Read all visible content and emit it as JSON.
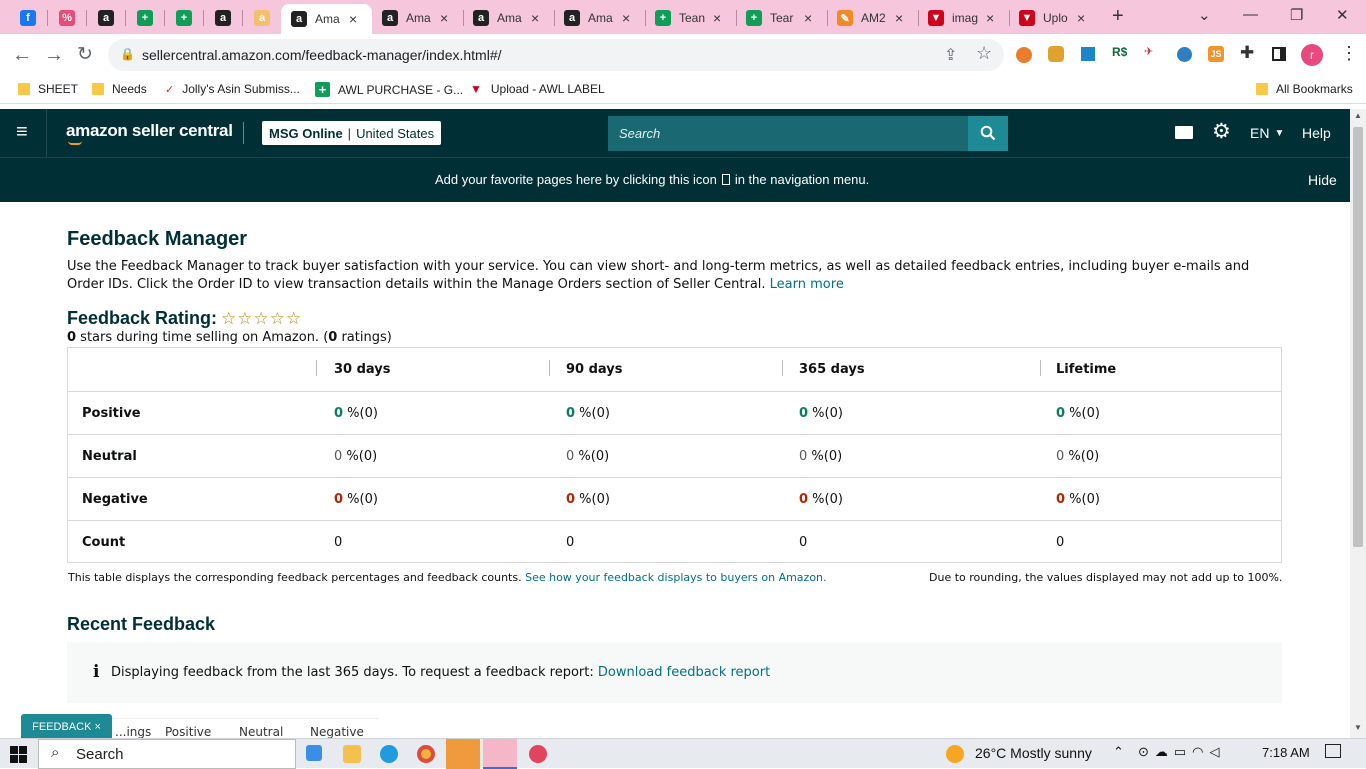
{
  "browser": {
    "tabs": [
      {
        "label": "",
        "icon": "facebook-icon",
        "color": "#1877f2",
        "glyph": "f"
      },
      {
        "label": "",
        "icon": "percent-icon",
        "color": "#e84c7d",
        "glyph": "%"
      },
      {
        "label": "",
        "icon": "amazon-icon",
        "color": "#222",
        "glyph": "a"
      },
      {
        "label": "",
        "icon": "sheets-icon",
        "color": "#0f9d58",
        "glyph": "+"
      },
      {
        "label": "",
        "icon": "sheets-icon",
        "color": "#0f9d58",
        "glyph": "+"
      },
      {
        "label": "",
        "icon": "amazon-icon",
        "color": "#222",
        "glyph": "a"
      },
      {
        "label": "",
        "icon": "amazon-smile-icon",
        "color": "#f3c16b",
        "glyph": "a"
      },
      {
        "label": "Ama",
        "icon": "amazon-icon",
        "color": "#222",
        "glyph": "a",
        "active": true
      },
      {
        "label": "Ama",
        "icon": "amazon-icon",
        "color": "#222",
        "glyph": "a"
      },
      {
        "label": "Ama",
        "icon": "amazon-icon",
        "color": "#222",
        "glyph": "a"
      },
      {
        "label": "Ama",
        "icon": "amazon-icon",
        "color": "#222",
        "glyph": "a"
      },
      {
        "label": "Tean",
        "icon": "sheets-icon",
        "color": "#0f9d58",
        "glyph": "+"
      },
      {
        "label": "Tear",
        "icon": "sheets-icon",
        "color": "#0f9d58",
        "glyph": "+"
      },
      {
        "label": "AM2",
        "icon": "pencil-icon",
        "color": "#f08a24",
        "glyph": "✎"
      },
      {
        "label": "imag",
        "icon": "upload-triangle-icon",
        "color": "#d0021b",
        "glyph": "▼"
      },
      {
        "label": "Uplo",
        "icon": "upload-triangle-icon",
        "color": "#d0021b",
        "glyph": "▼"
      }
    ],
    "new_tab": "+",
    "url": "sellercentral.amazon.com/feedback-manager/index.html#/",
    "profile_initial": "r",
    "bookmarks": [
      {
        "label": "SHEET",
        "icon": "folder-icon"
      },
      {
        "label": "Needs",
        "icon": "folder-icon"
      },
      {
        "label": "Jolly's Asin Submiss...",
        "icon": "bookmark-site-icon"
      },
      {
        "label": "AWL PURCHASE - G...",
        "icon": "sheets-icon"
      },
      {
        "label": "Upload - AWL LABEL",
        "icon": "upload-triangle-icon"
      }
    ],
    "all_bookmarks": "All Bookmarks"
  },
  "header": {
    "logo": "amazon seller central",
    "store": "MSG Online",
    "marketplace": "United States",
    "search_placeholder": "Search",
    "language": "EN",
    "help": "Help"
  },
  "banner": {
    "text_before": "Add your favorite pages here by clicking this icon",
    "text_after": "in the navigation menu.",
    "hide": "Hide"
  },
  "page": {
    "title": "Feedback Manager",
    "description": "Use the Feedback Manager to track buyer satisfaction with your service. You can view short- and long-term metrics, as well as detailed feedback entries, including buyer e-mails and Order IDs. Click the Order ID to view transaction details within the Manage Orders section of Seller Central.",
    "learn_more": "Learn more",
    "rating_label": "Feedback Rating:",
    "stars": 0,
    "rating_count_star": "0",
    "rating_mid": " stars during time selling on Amazon. (",
    "rating_count": "0",
    "rating_end": " ratings)"
  },
  "table": {
    "columns": [
      "30 days",
      "90 days",
      "365 days",
      "Lifetime"
    ],
    "rows": [
      {
        "label": "Positive",
        "kind": "pos",
        "values": [
          {
            "n": "0",
            "rest": " %(0)"
          },
          {
            "n": "0",
            "rest": " %(0)"
          },
          {
            "n": "0",
            "rest": " %(0)"
          },
          {
            "n": "0",
            "rest": " %(0)"
          }
        ]
      },
      {
        "label": "Neutral",
        "kind": "neu",
        "values": [
          {
            "n": "0",
            "rest": " %(0)"
          },
          {
            "n": "0",
            "rest": " %(0)"
          },
          {
            "n": "0",
            "rest": " %(0)"
          },
          {
            "n": "0",
            "rest": " %(0)"
          }
        ]
      },
      {
        "label": "Negative",
        "kind": "neg",
        "values": [
          {
            "n": "0",
            "rest": " %(0)"
          },
          {
            "n": "0",
            "rest": " %(0)"
          },
          {
            "n": "0",
            "rest": " %(0)"
          },
          {
            "n": "0",
            "rest": " %(0)"
          }
        ]
      },
      {
        "label": "Count",
        "kind": "count",
        "values": [
          {
            "n": "",
            "rest": "0"
          },
          {
            "n": "",
            "rest": "0"
          },
          {
            "n": "",
            "rest": "0"
          },
          {
            "n": "",
            "rest": "0"
          }
        ]
      }
    ],
    "note_left": "This table displays the corresponding feedback percentages and feedback counts.",
    "note_link": "See how your feedback displays to buyers on Amazon.",
    "note_right": "Due to rounding, the values displayed may not add up to 100%."
  },
  "recent": {
    "title": "Recent Feedback",
    "info_text": "Displaying feedback from the last 365 days. To request a feedback report:",
    "info_link": "Download feedback report",
    "partial_tabs": [
      "...ings",
      "Positive",
      "Neutral",
      "Negative"
    ]
  },
  "feedback_chip": "FEEDBACK ×",
  "taskbar": {
    "search": "Search",
    "weather": "26°C  Mostly sunny",
    "time": "7:18 AM"
  },
  "colors": {
    "header_bg": "#002f36",
    "search_bg": "#1a6872",
    "positive": "#067d62",
    "negative": "#b12704",
    "link": "#007185"
  }
}
